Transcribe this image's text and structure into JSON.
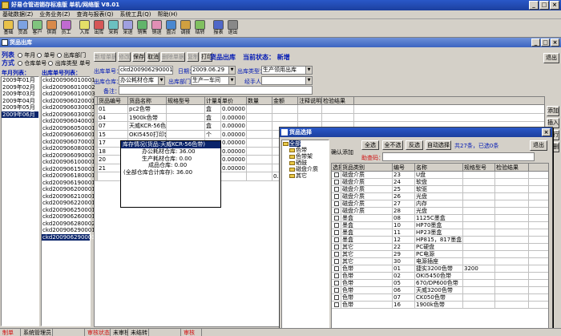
{
  "app": {
    "title": "好易仓管进销存标准版 单机/网络版 V8.01"
  },
  "menu": [
    "基础数据(Z)",
    "业务业务(Z)",
    "查询与报表(Q)",
    "系统工具(Q)",
    "帮助(H)"
  ],
  "toolbar": [
    {
      "label": "基础",
      "icon": "database-icon",
      "color": "#e9c24a"
    },
    {
      "label": "货品",
      "icon": "goods-icon",
      "color": "#7ca2e2"
    },
    {
      "label": "客户",
      "icon": "customer-icon",
      "color": "#7fc47e"
    },
    {
      "label": "供商",
      "icon": "supplier-icon",
      "color": "#d98a4a"
    },
    {
      "label": "员工",
      "icon": "employee-icon",
      "color": "#c06ad0"
    },
    {
      "label": "入库",
      "icon": "stock-in-icon",
      "color": "#e4e067"
    },
    {
      "label": "出库",
      "icon": "stock-out-icon",
      "color": "#d65757"
    },
    {
      "label": "采购",
      "icon": "purchase-icon",
      "color": "#6bc0c0"
    },
    {
      "label": "采退",
      "icon": "purchase-return-icon",
      "color": "#a0a0e0"
    },
    {
      "label": "销售",
      "icon": "sales-icon",
      "color": "#62b46b"
    },
    {
      "label": "销退",
      "icon": "sales-return-icon",
      "color": "#e28fb5"
    },
    {
      "label": "盘点",
      "icon": "inventory-icon",
      "color": "#4a88d0"
    },
    {
      "label": "调拨",
      "icon": "transfer-icon",
      "color": "#d0a040"
    },
    {
      "label": "结转",
      "icon": "carryover-icon",
      "color": "#80c060"
    },
    {
      "label": "报表",
      "icon": "report-icon",
      "color": "#5068c8"
    },
    {
      "label": "退出",
      "icon": "exit-icon",
      "color": "#888888"
    }
  ],
  "form": {
    "title": "货品出库",
    "exit": "退出"
  },
  "left": {
    "list_label1": "列表",
    "list_label2": "方式",
    "radios": [
      "年月",
      "单号",
      "出库部门",
      "仓库单号",
      "出库类型",
      "单号"
    ],
    "col1": "年月列表：",
    "col2": "出库单号列表：",
    "months": [
      "2009年01月",
      "2009年02月",
      "2009年03月",
      "2009年04月",
      "2009年05月",
      "2009年06月"
    ],
    "orders": [
      "ckd200906010001",
      "ckd200906010002",
      "ckd200906010003",
      "ckd200906020001",
      "ckd200906030001",
      "ckd200906030002",
      "ckd200906040001",
      "ckd200906050001",
      "ckd200906060001",
      "ckd200906070001",
      "ckd200906080001",
      "ckd200906090001",
      "ckd200906100001",
      "ckd200906150001",
      "ckd200906180001",
      "ckd200906190001",
      "ckd200906200001",
      "ckd200906210001",
      "ckd200906220001",
      "ckd200906250001",
      "ckd200906260001",
      "ckd200906280002",
      "ckd200906290001",
      "ckd200906290003"
    ]
  },
  "actions": [
    "新增单据",
    "修改",
    "保存",
    "取消",
    "删除单据",
    "复制",
    "打印"
  ],
  "header": {
    "title": "货品出库",
    "status": "当前状态： 新增",
    "order_label": "出库单号：",
    "order_value": "ckd200906290001",
    "date_label": "日期：",
    "date_value": "2009.06.29",
    "type_label": "出库类型：",
    "type_value": "生产领用出库",
    "warehouse_label": "出库仓库：",
    "warehouse_value": "办公耗材仓库",
    "dept_label": "出库部门：",
    "dept_value": "生产一车间",
    "handler_label": "经手人：",
    "remark_label": "备注："
  },
  "grid": {
    "columns": [
      "货品编号",
      "货品名称",
      "规格型号",
      "计量单位",
      "单价",
      "数量",
      "金额",
      "注释说明",
      "检验结果"
    ],
    "rows": [
      [
        "01",
        "pc2色带",
        "",
        "盒",
        "0.00000",
        "",
        ""
      ],
      [
        "04",
        "1900k色带",
        "",
        "盒",
        "0.00000",
        "",
        ""
      ],
      [
        "07",
        "天威KCR-56色带",
        "",
        "盒",
        "0.00000",
        "",
        ""
      ],
      [
        "15",
        "OKI5450打印套简",
        "",
        "个",
        "0.00000",
        "",
        ""
      ],
      [
        "17",
        "",
        "",
        "",
        "0.00000",
        "",
        ""
      ],
      [
        "18",
        "",
        "",
        "",
        "0.00000",
        "",
        ""
      ],
      [
        "20",
        "",
        "",
        "",
        "0.00000",
        "",
        ""
      ],
      [
        "21",
        "",
        "",
        "",
        "0.00000",
        "",
        ""
      ],
      [
        "",
        "",
        "",
        "",
        "",
        "",
        "0.00"
      ]
    ]
  },
  "tooltip": {
    "title": "库存情况(货品:天威KCR-56色带)",
    "lines": [
      "办公耗材仓库: 36.00",
      "生产耗材仓库: 0.00",
      "成品仓库: 0.00",
      "(全部仓库合计库存): 36.00"
    ]
  },
  "side": [
    "添加",
    "插入",
    "删行",
    "全删"
  ],
  "popup": {
    "title": "货品选择",
    "tree": [
      "全部",
      "色带",
      "色带架",
      "硒鼓",
      "磁盘介质",
      "其它"
    ],
    "confirm": "确认添加",
    "buttons": [
      "全选",
      "全不选",
      "反选",
      "自动选择"
    ],
    "count": "共27条，已选0条",
    "exit": "退出",
    "filter_label": "助查码：",
    "columns": [
      "选择",
      "货品类别",
      "编号",
      "名称",
      "规格型号",
      "检验结果"
    ],
    "rows": [
      [
        "磁盘介质",
        "23",
        "U盘",
        ""
      ],
      [
        "磁盘介质",
        "24",
        "软盘",
        ""
      ],
      [
        "磁盘介质",
        "25",
        "软驱",
        ""
      ],
      [
        "磁盘介质",
        "26",
        "光盘",
        ""
      ],
      [
        "磁盘介质",
        "27",
        "内存",
        ""
      ],
      [
        "磁盘介质",
        "28",
        "光盘",
        ""
      ],
      [
        "墨盒",
        "08",
        "1125C墨盒",
        ""
      ],
      [
        "墨盒",
        "10",
        "HP70墨盒",
        ""
      ],
      [
        "墨盒",
        "11",
        "HP23墨盒",
        ""
      ],
      [
        "墨盒",
        "12",
        "HP815，817墨盒",
        ""
      ],
      [
        "其它",
        "22",
        "PC硬盘",
        ""
      ],
      [
        "其它",
        "29",
        "PC电源",
        ""
      ],
      [
        "其它",
        "30",
        "电源插座",
        ""
      ],
      [
        "色带",
        "01",
        "捷实3200色带",
        "3200"
      ],
      [
        "色带",
        "02",
        "OKI5450色带",
        ""
      ],
      [
        "色带",
        "05",
        "670/DP600色带",
        ""
      ],
      [
        "色带",
        "06",
        "天威3200色带",
        ""
      ],
      [
        "色带",
        "07",
        "CK050色带",
        ""
      ],
      [
        "色带",
        "16",
        "1900k色带",
        ""
      ]
    ]
  },
  "statusbar": [
    "制单",
    "系统管理员",
    "",
    "审核状态",
    "未审核",
    "未结转",
    "",
    "审核"
  ]
}
